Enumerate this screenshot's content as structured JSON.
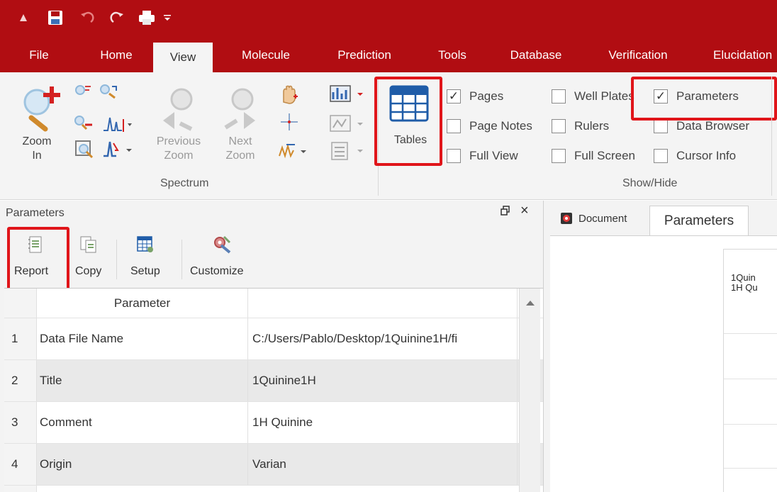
{
  "tabs": [
    {
      "label": "File"
    },
    {
      "label": "Home"
    },
    {
      "label": "View"
    },
    {
      "label": "Molecule"
    },
    {
      "label": "Prediction"
    },
    {
      "label": "Tools"
    },
    {
      "label": "Database"
    },
    {
      "label": "Verification"
    },
    {
      "label": "Elucidation"
    }
  ],
  "ribbon": {
    "zoom_in": "Zoom\nIn",
    "previous_zoom": "Previous\nZoom",
    "next_zoom": "Next\nZoom",
    "spectrum_group": "Spectrum",
    "tables": "Tables",
    "show_hide_group": "Show/Hide",
    "checks": [
      {
        "label": "Pages",
        "checked": true
      },
      {
        "label": "Page Notes",
        "checked": false
      },
      {
        "label": "Full View",
        "checked": false
      },
      {
        "label": "Well Plates",
        "checked": false
      },
      {
        "label": "Rulers",
        "checked": false
      },
      {
        "label": "Full Screen",
        "checked": false
      },
      {
        "label": "Parameters",
        "checked": true
      },
      {
        "label": "Data Browser",
        "checked": false
      },
      {
        "label": "Cursor Info",
        "checked": false
      }
    ]
  },
  "panel": {
    "title": "Parameters",
    "pin_icon": "Ѣ",
    "close_icon": "×",
    "tools": [
      {
        "label": "Report"
      },
      {
        "label": "Copy"
      },
      {
        "label": "Setup"
      },
      {
        "label": "Customize"
      }
    ],
    "grid": {
      "header": "Parameter",
      "rows": [
        {
          "num": "1",
          "name": "Data File Name",
          "value": "C:/Users/Pablo/Desktop/1Quinine1H/fi"
        },
        {
          "num": "2",
          "name": "Title",
          "value": "1Quinine1H"
        },
        {
          "num": "3",
          "name": "Comment",
          "value": "1H Quinine"
        },
        {
          "num": "4",
          "name": "Origin",
          "value": "Varian"
        }
      ]
    }
  },
  "document": {
    "tabs": [
      {
        "label": "Document"
      },
      {
        "label": "Parameters"
      }
    ],
    "preview_lines": [
      "1Quin",
      "1H Qu"
    ]
  },
  "colors": {
    "brand_red": "#b10d12",
    "highlight_red": "#e0151a"
  }
}
